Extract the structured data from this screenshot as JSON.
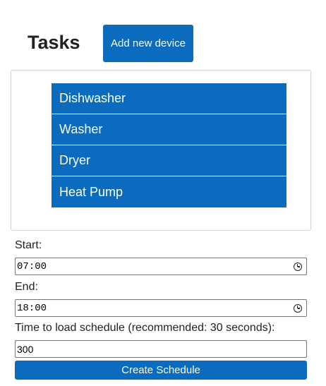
{
  "header": {
    "title": "Tasks",
    "add_button_label": "Add new device"
  },
  "devices": [
    {
      "label": "Dishwasher"
    },
    {
      "label": "Washer"
    },
    {
      "label": "Dryer"
    },
    {
      "label": "Heat Pump"
    }
  ],
  "form": {
    "start_label": "Start:",
    "start_value": "07:00",
    "end_label": "End:",
    "end_value": "18:00",
    "load_time_label": "Time to load schedule (recommended: 30 seconds):",
    "load_time_value": "300",
    "create_button_label": "Create Schedule"
  },
  "colors": {
    "accent": "#0a6bbf",
    "panel_border": "#d0d0d0"
  }
}
